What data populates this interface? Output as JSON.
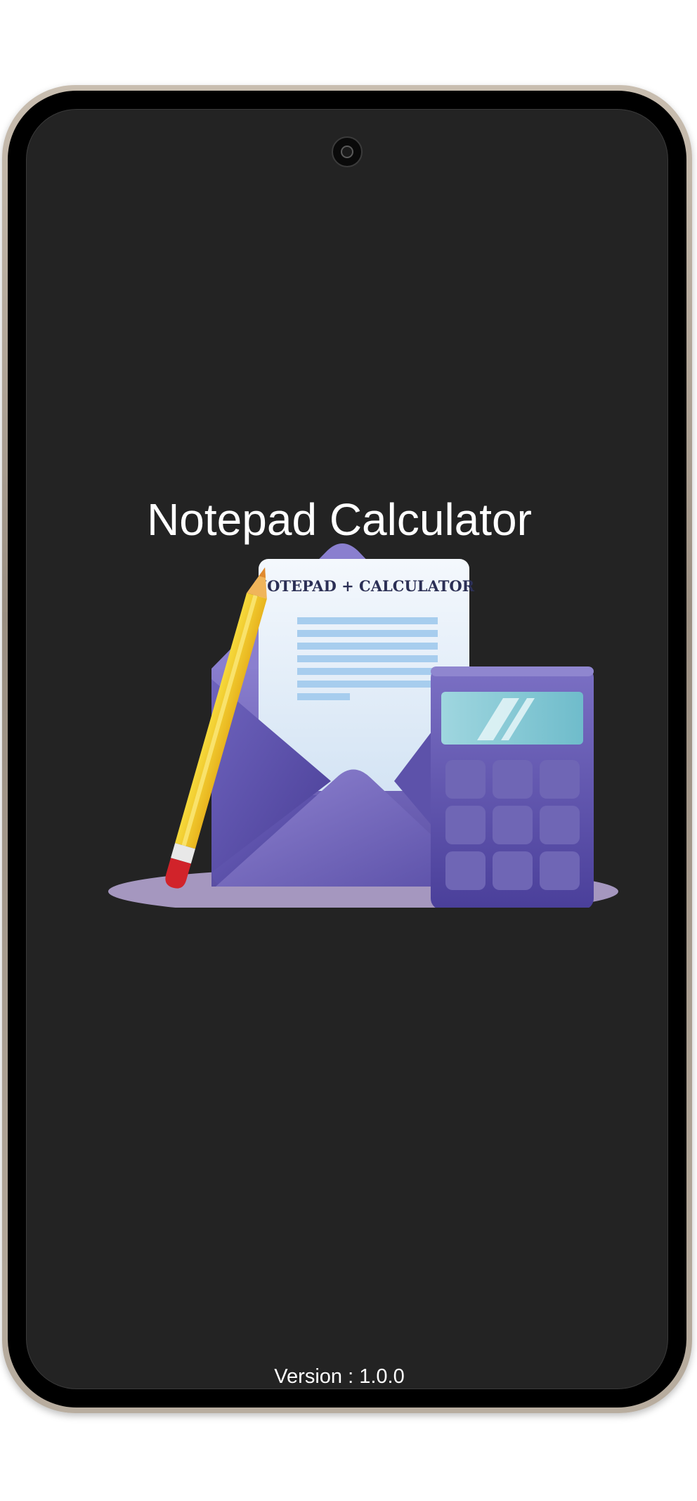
{
  "app": {
    "title": "Notepad Calculator",
    "version_text": "Version : 1.0.0"
  },
  "illustration": {
    "note_header": "NOTEPAD + CALCULATOR",
    "icon": "notepad-calculator-illustration"
  },
  "colors": {
    "screen_background": "#232323",
    "text": "#ffffff",
    "accent_purple": "#6e62b4",
    "pencil_yellow": "#f2cb2b"
  }
}
